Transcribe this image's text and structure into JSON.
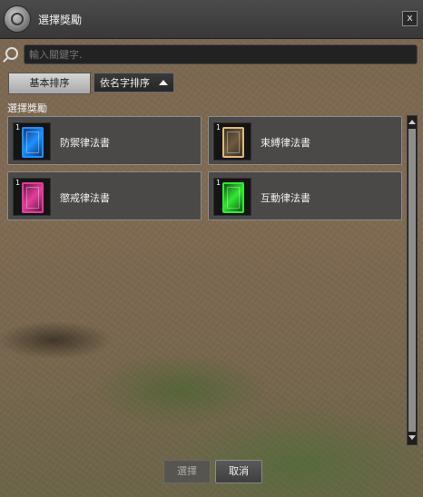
{
  "window": {
    "title": "選擇獎勵",
    "close_label": "x"
  },
  "search": {
    "placeholder": "輸入關鍵字."
  },
  "sort": {
    "basic_label": "基本排序",
    "by_name_label": "依名字排序"
  },
  "section_label": "選擇獎勵",
  "rewards": [
    {
      "name": "防禦律法書",
      "count": "1",
      "color": "#1f8fff"
    },
    {
      "name": "束縛律法書",
      "count": "1",
      "color": "#e0b878"
    },
    {
      "name": "懲戒律法書",
      "count": "1",
      "color": "#e0409a"
    },
    {
      "name": "互動律法書",
      "count": "1",
      "color": "#33e833"
    }
  ],
  "footer": {
    "select_label": "選擇",
    "cancel_label": "取消"
  }
}
